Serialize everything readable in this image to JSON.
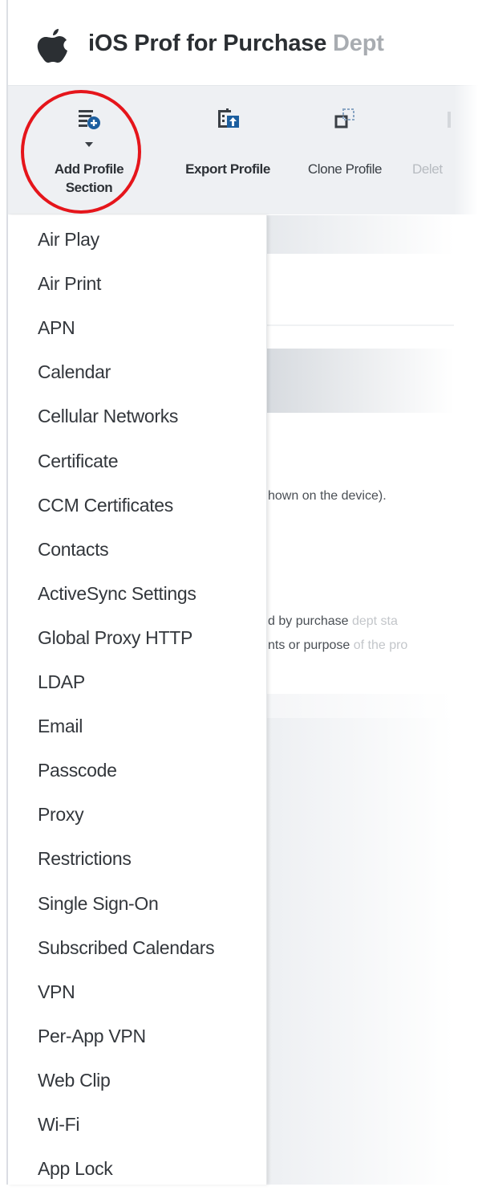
{
  "header": {
    "title_main": "iOS Prof for Purchase",
    "title_faded": " Dept"
  },
  "icons": {
    "brand": "apple-logo-icon",
    "add_profile_section": "list-add-icon",
    "export_profile": "calendar-export-icon",
    "clone_profile": "clone-icon",
    "delete": "delete-icon"
  },
  "toolbar": {
    "add_profile_section_line1": "Add Profile",
    "add_profile_section_line2": "Section",
    "export_profile": "Export Profile",
    "clone_profile": "Clone Profile",
    "delete_partial": "Delet"
  },
  "background": {
    "text1": "hown on the device).",
    "text2_visible": "d by purchase",
    "text2_faded": " dept sta",
    "text3_visible": "nts or purpose",
    "text3_faded": " of the pro"
  },
  "menu": {
    "items": [
      "Air Play",
      "Air Print",
      "APN",
      "Calendar",
      "Cellular Networks",
      "Certificate",
      "CCM Certificates",
      "Contacts",
      "ActiveSync Settings",
      "Global Proxy HTTP",
      "LDAP",
      "Email",
      "Passcode",
      "Proxy",
      "Restrictions",
      "Single Sign-On",
      "Subscribed Calendars",
      "VPN",
      "Per-App VPN",
      "Web Clip",
      "Wi-Fi",
      "App Lock"
    ]
  },
  "colors": {
    "highlight_ring": "#e5151b",
    "accent_blue": "#1d5f9f",
    "toolbar_bg": "#eef0f3"
  }
}
